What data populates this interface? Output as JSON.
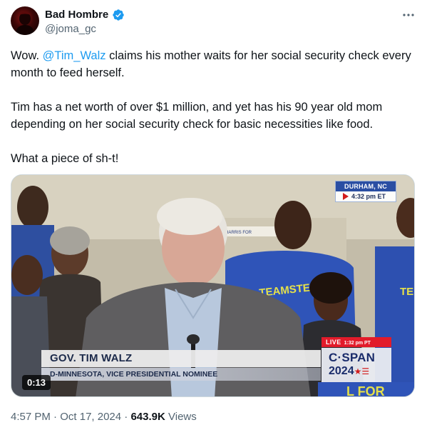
{
  "author": {
    "display_name": "Bad Hombre",
    "handle": "@joma_gc",
    "verified": true
  },
  "tweet": {
    "paragraph_1_prefix": "Wow. ",
    "mention": "@Tim_Walz",
    "paragraph_1_suffix": " claims his mother waits for her social security check every month to feed herself.",
    "paragraph_2": "Tim has a net worth of over $1 million, and yet has his 90 year old mom depending on her social security check for basic necessities like food.",
    "paragraph_3": "What a piece of sh-t!"
  },
  "video": {
    "location": "DURHAM, NC",
    "location_time": "4:32 pm ET",
    "chyron_name": "GOV. TIM WALZ",
    "chyron_title": "D-MINNESOTA, VICE PRESIDENTIAL NOMINEE",
    "live_label": "LIVE",
    "live_time": "1:32 pm PT",
    "network_brand": "C·SPAN",
    "network_year": "2024",
    "network_star": "★☰",
    "duration": "0:13",
    "sign_text": "TEAMSTE HAR",
    "sign_text_right": "TE",
    "banner_text": "HARRIS FOR",
    "bottom_sign_text": "L FOR"
  },
  "footer": {
    "time": "4:57 PM",
    "date": "Oct 17, 2024",
    "separator": "·",
    "views_count": "643.9K",
    "views_label": "Views"
  },
  "colors": {
    "link": "#1d9bf0",
    "secondary_text": "#536471",
    "verified_badge": "#1d9bf0",
    "live_red": "#e21b2a",
    "cspan_blue": "#1a2c6b"
  },
  "icons": [
    "verified-badge-icon",
    "more-options-icon"
  ]
}
